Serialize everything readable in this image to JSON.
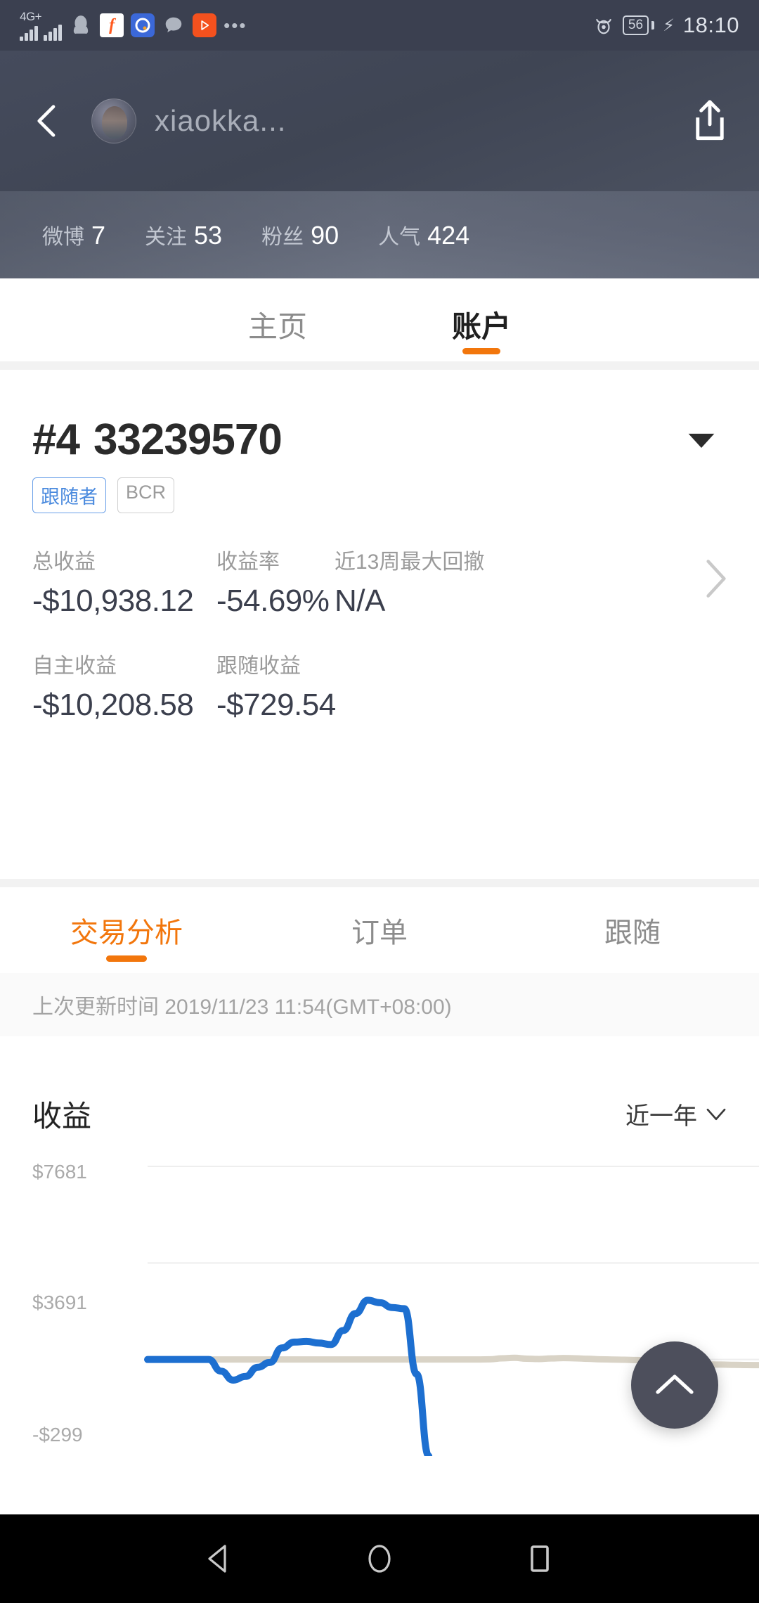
{
  "status_bar": {
    "network_type": "4G+",
    "signal_label": "signal-bars",
    "app_icons": [
      "qq-icon",
      "f-app-icon",
      "browser-icon",
      "chat-icon",
      "video-player-icon",
      "more-dots-icon"
    ],
    "eye_icon": "eye-protection-icon",
    "battery": "56",
    "charging_icon": "lightning-bolt-icon",
    "time": "18:10"
  },
  "profile_header": {
    "back_icon": "back-chevron-icon",
    "avatar": "user-avatar",
    "username": "xiaokka...",
    "share_icon": "share-icon"
  },
  "profile_stats": [
    {
      "label": "微博",
      "value": "7"
    },
    {
      "label": "关注",
      "value": "53"
    },
    {
      "label": "粉丝",
      "value": "90"
    },
    {
      "label": "人气",
      "value": "424"
    }
  ],
  "top_tabs": [
    {
      "label": "主页",
      "active": false
    },
    {
      "label": "账户",
      "active": true
    }
  ],
  "account": {
    "rank": "#4",
    "number": "33239570",
    "dropdown_icon": "caret-down-icon",
    "badges": [
      {
        "text": "跟随者",
        "style": "blue"
      },
      {
        "text": "BCR",
        "style": "gray"
      }
    ],
    "metrics_row1": [
      {
        "label": "总收益",
        "value": "-$10,938.12"
      },
      {
        "label": "收益率",
        "value": "-54.69%"
      },
      {
        "label": "近13周最大回撤",
        "value": "N/A"
      }
    ],
    "metrics_row2": [
      {
        "label": "自主收益",
        "value": "-$10,208.58"
      },
      {
        "label": "跟随收益",
        "value": "-$729.54"
      }
    ],
    "detail_chevron_icon": "chevron-right-icon"
  },
  "analysis_tabs": [
    {
      "label": "交易分析",
      "active": true
    },
    {
      "label": "订单",
      "active": false
    },
    {
      "label": "跟随",
      "active": false
    }
  ],
  "last_updated": "上次更新时间 2019/11/23 11:54(GMT+08:00)",
  "chart_header": {
    "title": "收益",
    "range_label": "近一年",
    "range_icon": "chevron-down-icon"
  },
  "floating_button": {
    "icon": "scroll-to-top-icon"
  },
  "nav_bar": {
    "back": "nav-back-triangle-icon",
    "home": "nav-home-circle-icon",
    "recents": "nav-recents-square-icon"
  },
  "colors": {
    "accent_orange": "#f2760c",
    "badge_blue": "#4a8ade",
    "series_blue": "#1d6fd0",
    "series_beige": "#d9d3c6",
    "status_bar_bg": "#3b4050",
    "fab_bg": "#4d4f5c"
  },
  "chart_data": {
    "type": "line",
    "title": "收益",
    "xlabel": "",
    "ylabel": "",
    "grid": true,
    "legend_position": "none",
    "y_ticks": [
      -299,
      3691,
      7681
    ],
    "y_tick_labels": [
      "-$299",
      "$3691",
      "$7681"
    ],
    "ylim": [
      -4289,
      7681
    ],
    "x": [
      0,
      1,
      2,
      3,
      4,
      5,
      6,
      7,
      8,
      9,
      10,
      11,
      12,
      13,
      14,
      15,
      16,
      17,
      18,
      19,
      20,
      21,
      22,
      23,
      24,
      25,
      26,
      27,
      28,
      29,
      30,
      31,
      32,
      33,
      34,
      35,
      36,
      37,
      38,
      39,
      40,
      41,
      42,
      43,
      44,
      45,
      46,
      47,
      48,
      49,
      50
    ],
    "series": [
      {
        "name": "自主收益",
        "color": "#1d6fd0",
        "values": [
          -299,
          -299,
          -299,
          -299,
          -299,
          -299,
          -780,
          -1150,
          -1000,
          -620,
          -420,
          180,
          420,
          450,
          380,
          320,
          900,
          1600,
          2150,
          2050,
          1850,
          1800,
          -900,
          -4289,
          null,
          null,
          null,
          null,
          null,
          null,
          null,
          null,
          null,
          null,
          null,
          null,
          null,
          null,
          null,
          null,
          null,
          null,
          null,
          null,
          null,
          null,
          null,
          null,
          null,
          null,
          null
        ]
      },
      {
        "name": "跟随收益",
        "color": "#d9d3c6",
        "values": [
          -299,
          -299,
          -299,
          -299,
          -299,
          -299,
          -299,
          -299,
          -299,
          -299,
          -299,
          -299,
          -299,
          -299,
          -299,
          -299,
          -299,
          -299,
          -299,
          -299,
          -299,
          -299,
          -299,
          -299,
          -299,
          -299,
          -299,
          -299,
          -290,
          -250,
          -230,
          -265,
          -280,
          -255,
          -240,
          -250,
          -270,
          -290,
          -300,
          -310,
          -320,
          -330,
          -345,
          -360,
          -480,
          -500,
          -505,
          -510,
          -520,
          -528,
          -530
        ]
      }
    ]
  }
}
